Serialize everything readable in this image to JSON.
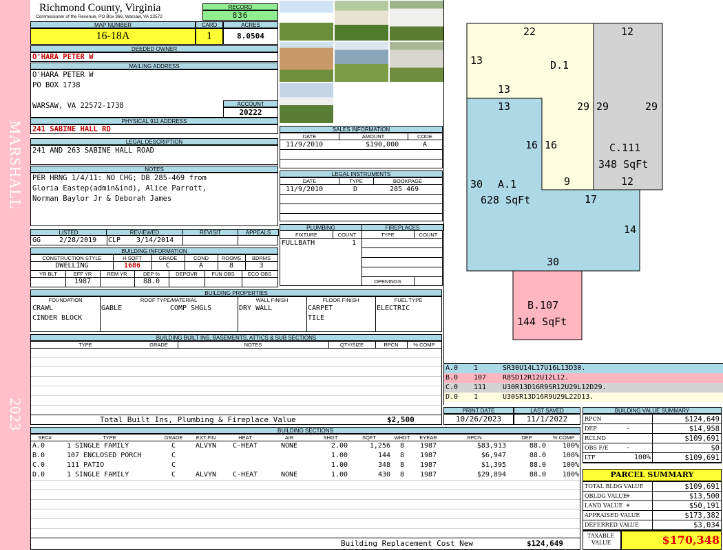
{
  "side_banner": {
    "name": "MARSHALL",
    "year": "2023"
  },
  "header": {
    "county": "Richmond County, Virginia",
    "commissioner": "Commissioner of the Revenue, PO Box 366, Warsaw, VA 22572",
    "record_label": "RECORD",
    "record": "836"
  },
  "parcel": {
    "map_label": "MAP NUMBER",
    "map_number": "16-18A",
    "card_label": "CARD",
    "card": "1",
    "acres_label": "ACRES",
    "acres": "8.0504"
  },
  "owner": {
    "deeded_label": "DEEDED OWNER",
    "deeded": "O'HARA PETER W",
    "mailing_label": "MAILING ADDRESS",
    "mailing_lines": [
      "O'HARA PETER W",
      "PO BOX 1738",
      "",
      "WARSAW, VA 22572-1738"
    ],
    "account_label": "ACCOUNT",
    "account": "20222",
    "physical_label": "PHYSICAL 911 ADDRESS",
    "physical": "241 SABINE HALL RD"
  },
  "legal": {
    "label": "LEGAL DESCRIPTION",
    "text": "241 AND 263 SABINE HALL ROAD"
  },
  "notes": {
    "label": "NOTES",
    "lines": [
      "PER HRNG 1/4/11: NO CHG; DB 285-469 from",
      "Gloria Eastep(admin&ind), Alice Parrott,",
      "Norman Baylor Jr & Deborah James"
    ]
  },
  "sales": {
    "label": "SALES INFORMATION",
    "headers": [
      "DATE",
      "AMOUNT",
      "CODE"
    ],
    "rows": [
      [
        "11/9/2010",
        "$190,000",
        "A"
      ]
    ]
  },
  "instruments": {
    "label": "LEGAL INSTRUMENTS",
    "headers": [
      "DATE",
      "TYPE",
      "BOOKPAGE"
    ],
    "rows": [
      [
        "11/9/2010",
        "D",
        "285 469"
      ]
    ]
  },
  "review": {
    "headers": [
      "LISTED",
      "REVIEWED",
      "REVISIT",
      "APPEALS"
    ],
    "listed_by": "GG",
    "listed": "2/28/2019",
    "reviewed_by": "CLP",
    "reviewed": "3/14/2014"
  },
  "plumbing": {
    "label": "PLUMBING",
    "headers": [
      "FIXTURE",
      "COUNT"
    ],
    "rows": [
      [
        "FULLBATH",
        "1"
      ]
    ]
  },
  "fireplaces": {
    "label": "FIREPLACES",
    "headers": [
      "TYPE",
      "COUNT"
    ],
    "openings_label": "OPENINGS"
  },
  "building_info": {
    "label": "BUILDING INFORMATION",
    "headers1": [
      "CONSTRUCTION STYLE",
      "H SQFT",
      "GRADE",
      "COND",
      "ROOMS",
      "BDRMS"
    ],
    "values1": [
      "DWELLING",
      "1686",
      "C",
      "A",
      "8",
      "3"
    ],
    "headers2": [
      "YR BLT",
      "EFF YR",
      "REM YR",
      "DEP %",
      "DEPOVR",
      "FUN OBS",
      "ECO OBS"
    ],
    "values2": [
      "",
      "1987",
      "",
      "88.0",
      "",
      "",
      ""
    ]
  },
  "properties": {
    "label": "BUILDING PROPERTIES",
    "headers": [
      "FOUNDATION",
      "ROOF TYPE/MATERIAL",
      "WALL FINISH",
      "FLOOR FINISH",
      "FUEL TYPE"
    ],
    "foundation": [
      "CRAWL",
      "CINDER BLOCK"
    ],
    "roof_type": "GABLE",
    "roof_material": "COMP SHGLS",
    "wall": "DRY WALL",
    "floor": [
      "CARPET",
      "TILE"
    ],
    "fuel": "ELECTRIC"
  },
  "builtins": {
    "label": "BUILDING BUILT INS, BASEMENTS, ATTICS & SUB SECTIONS",
    "headers": [
      "TYPE",
      "GRADE",
      "NOTES",
      "QTY/SIZE",
      "RPCN",
      "% COMP"
    ],
    "total_label": "Total Built Ins, Plumbing & Fireplace Value",
    "total": "$2,500"
  },
  "sketch": {
    "areas": [
      {
        "code": "D.1",
        "color": "#fffde0"
      },
      {
        "code": "C.111",
        "area": "348 SqFt",
        "color": "#d3d3d3"
      },
      {
        "code": "A.1",
        "area": "628 SqFt",
        "color": "#add8e6"
      },
      {
        "code": "B.107",
        "area": "144 SqFt",
        "color": "#ffb6c1"
      }
    ],
    "dims": [
      "22",
      "12",
      "13",
      "13",
      "13",
      "29",
      "29",
      "29",
      "16",
      "16",
      "9",
      "12",
      "30",
      "17",
      "14",
      "30"
    ],
    "legend": [
      {
        "code": "A.0",
        "num": "1",
        "desc": "SR30U14L17U16L13D30.",
        "color": "#add8e6"
      },
      {
        "code": "B.0",
        "num": "107",
        "desc": "R8SD12R12U12L12.",
        "color": "#ffb6c1"
      },
      {
        "code": "C.0",
        "num": "111",
        "desc": "U30R13D16R9SR12U29L12D29.",
        "color": "#d3d3d3"
      },
      {
        "code": "D.0",
        "num": "1",
        "desc": "U30SR13D16R9U29L22D13.",
        "color": "#fffde0"
      }
    ]
  },
  "dates": {
    "print_label": "PRINT DATE",
    "print": "10/26/2023",
    "saved_label": "LAST SAVED",
    "saved": "11/1/2022"
  },
  "sections": {
    "label": "BUILDING SECTIONS",
    "headers": [
      "SEC#",
      "TYPE",
      "GRADE",
      "EXT FIN",
      "HEAT",
      "AIR",
      "SHGT",
      "SQFT",
      "WHGT",
      "EYEAR",
      "RPCN",
      "DEP",
      "% COMP"
    ],
    "rows": [
      [
        "A.0",
        "1 SINGLE FAMILY",
        "C",
        "ALVYN",
        "C-HEAT",
        "NONE",
        "2.00",
        "1,256",
        "8",
        "1987",
        "$83,913",
        "88.0",
        "100%"
      ],
      [
        "B.0",
        "107 ENCLOSED PORCH",
        "C",
        "",
        "",
        "",
        "1.00",
        "144",
        "8",
        "1987",
        "$6,947",
        "88.0",
        "100%"
      ],
      [
        "C.0",
        "111 PATIO",
        "C",
        "",
        "",
        "",
        "1.00",
        "348",
        "8",
        "1987",
        "$1,395",
        "88.0",
        "100%"
      ],
      [
        "D.0",
        "1 SINGLE FAMILY",
        "C",
        "ALVYN",
        "C-HEAT",
        "NONE",
        "1.00",
        "430",
        "8",
        "1987",
        "$29,894",
        "88.0",
        "100%"
      ]
    ],
    "replacement_label": "Building Replacement Cost New",
    "replacement": "$124,649"
  },
  "value_summary": {
    "label": "BUILDING VALUE SUMMARY",
    "rows": [
      {
        "label": "RPCN",
        "sign": "",
        "value": "$124,649"
      },
      {
        "label": "DEP",
        "sign": "-",
        "value": "$14,958"
      },
      {
        "label": "RCLND",
        "sign": "",
        "value": "$109,691"
      },
      {
        "label": "OBS F/E",
        "sign": "-",
        "value": "$0"
      },
      {
        "label": "LTF",
        "sign": "100%",
        "value": "$109,691"
      }
    ]
  },
  "parcel_summary": {
    "label": "PARCEL SUMMARY",
    "rows": [
      {
        "label": "TOTAL BLDG VALUE",
        "sign": "",
        "value": "$109,691"
      },
      {
        "label": "OBLDG VALUE",
        "sign": "+",
        "value": "$13,500"
      },
      {
        "label": "LAND VALUE",
        "sign": "+",
        "value": "$50,191"
      },
      {
        "label": "APPRAISED VALUE",
        "sign": "",
        "value": "$173,382"
      },
      {
        "label": "DEFERRED VALUE",
        "sign": "-",
        "value": "$3,034"
      }
    ],
    "taxable_label_1": "TAXABLE",
    "taxable_label_2": "VALUE",
    "taxable": "$170,348"
  }
}
